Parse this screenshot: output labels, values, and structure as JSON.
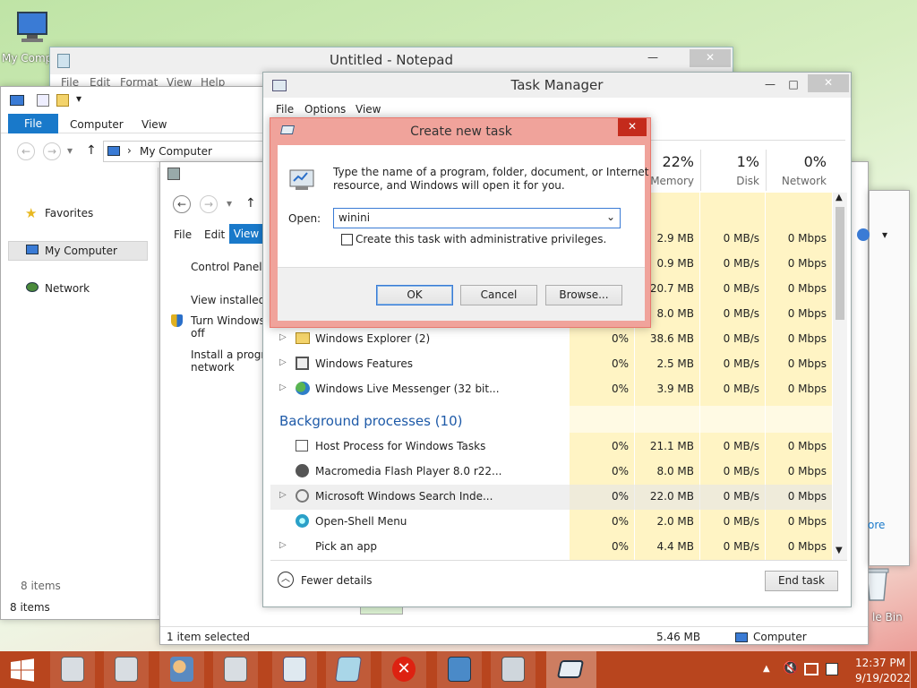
{
  "desktop": {
    "my_computer_label": "My Comp",
    "recycle_bin_label": "le Bin"
  },
  "notepad": {
    "title": "Untitled - Notepad",
    "menu": [
      "File",
      "Edit",
      "Format",
      "View",
      "Help"
    ]
  },
  "explorer": {
    "ribbon_tabs": [
      "File",
      "Computer",
      "View"
    ],
    "address": "My Computer",
    "nav": [
      "Favorites",
      "My Computer",
      "Network"
    ],
    "status_items": "8 items",
    "status_items2": "8 items"
  },
  "control_panel": {
    "menu": [
      "File",
      "Edit",
      "View"
    ],
    "home_link": "Control Panel H",
    "link_installed": "View installed u",
    "link_turn_windows": "Turn Windows",
    "link_turn_windows_2": "off",
    "link_install": "Install a prograr",
    "link_install_2": "network",
    "status": "1 item selected",
    "size": "5.46 MB",
    "computer": "Computer",
    "right_text": "ore"
  },
  "task_manager": {
    "title": "Task Manager",
    "menu": [
      "File",
      "Options",
      "View"
    ],
    "columns": {
      "memory_pct": "22%",
      "memory_label": "Memory",
      "disk_pct": "1%",
      "disk_label": "Disk",
      "network_pct": "0%",
      "network_label": "Network"
    },
    "top_rows": [
      {
        "mem": "2.9 MB",
        "disk": "0 MB/s",
        "net": "0 Mbps"
      },
      {
        "mem": "0.9 MB",
        "disk": "0 MB/s",
        "net": "0 Mbps"
      },
      {
        "mem": "20.7 MB",
        "disk": "0 MB/s",
        "net": "0 Mbps"
      },
      {
        "mem": "8.0 MB",
        "disk": "0 MB/s",
        "net": "0 Mbps"
      }
    ],
    "apps": [
      {
        "name": "Windows Explorer (2)",
        "cpu": "0%",
        "mem": "38.6 MB",
        "disk": "0 MB/s",
        "net": "0 Mbps"
      },
      {
        "name": "Windows Features",
        "cpu": "0%",
        "mem": "2.5 MB",
        "disk": "0 MB/s",
        "net": "0 Mbps"
      },
      {
        "name": "Windows Live Messenger (32 bit...",
        "cpu": "0%",
        "mem": "3.9 MB",
        "disk": "0 MB/s",
        "net": "0 Mbps"
      }
    ],
    "bg_header": "Background processes (10)",
    "bg": [
      {
        "name": "Host Process for Windows Tasks",
        "cpu": "0%",
        "mem": "21.1 MB",
        "disk": "0 MB/s",
        "net": "0 Mbps"
      },
      {
        "name": "Macromedia Flash Player 8.0 r22...",
        "cpu": "0%",
        "mem": "8.0 MB",
        "disk": "0 MB/s",
        "net": "0 Mbps"
      },
      {
        "name": "Microsoft Windows Search Inde...",
        "cpu": "0%",
        "mem": "22.0 MB",
        "disk": "0 MB/s",
        "net": "0 Mbps"
      },
      {
        "name": "Open-Shell Menu",
        "cpu": "0%",
        "mem": "2.0 MB",
        "disk": "0 MB/s",
        "net": "0 Mbps"
      },
      {
        "name": "Pick an app",
        "cpu": "0%",
        "mem": "4.4 MB",
        "disk": "0 MB/s",
        "net": "0 Mbps"
      }
    ],
    "fewer_details": "Fewer details",
    "end_task": "End task"
  },
  "run_dialog": {
    "title": "Create new task",
    "description": "Type the name of a program, folder, document, or Internet",
    "description_2": "resource, and Windows will open it for you.",
    "open_label": "Open:",
    "open_value": "winini",
    "admin_checkbox_label": "Create this task with administrative privileges.",
    "admin_checked": false,
    "ok": "OK",
    "cancel": "Cancel",
    "browse": "Browse..."
  },
  "taskbar": {
    "time": "12:37 PM",
    "date": "9/19/2022"
  },
  "colors": {
    "dialog_border": "#e8786e",
    "dialog_title": "#f0a39b",
    "explorer_accent": "#1979ca",
    "heat_column": "#fff4c4",
    "taskbar": "#b8451e",
    "close_red": "#c42b1c"
  }
}
